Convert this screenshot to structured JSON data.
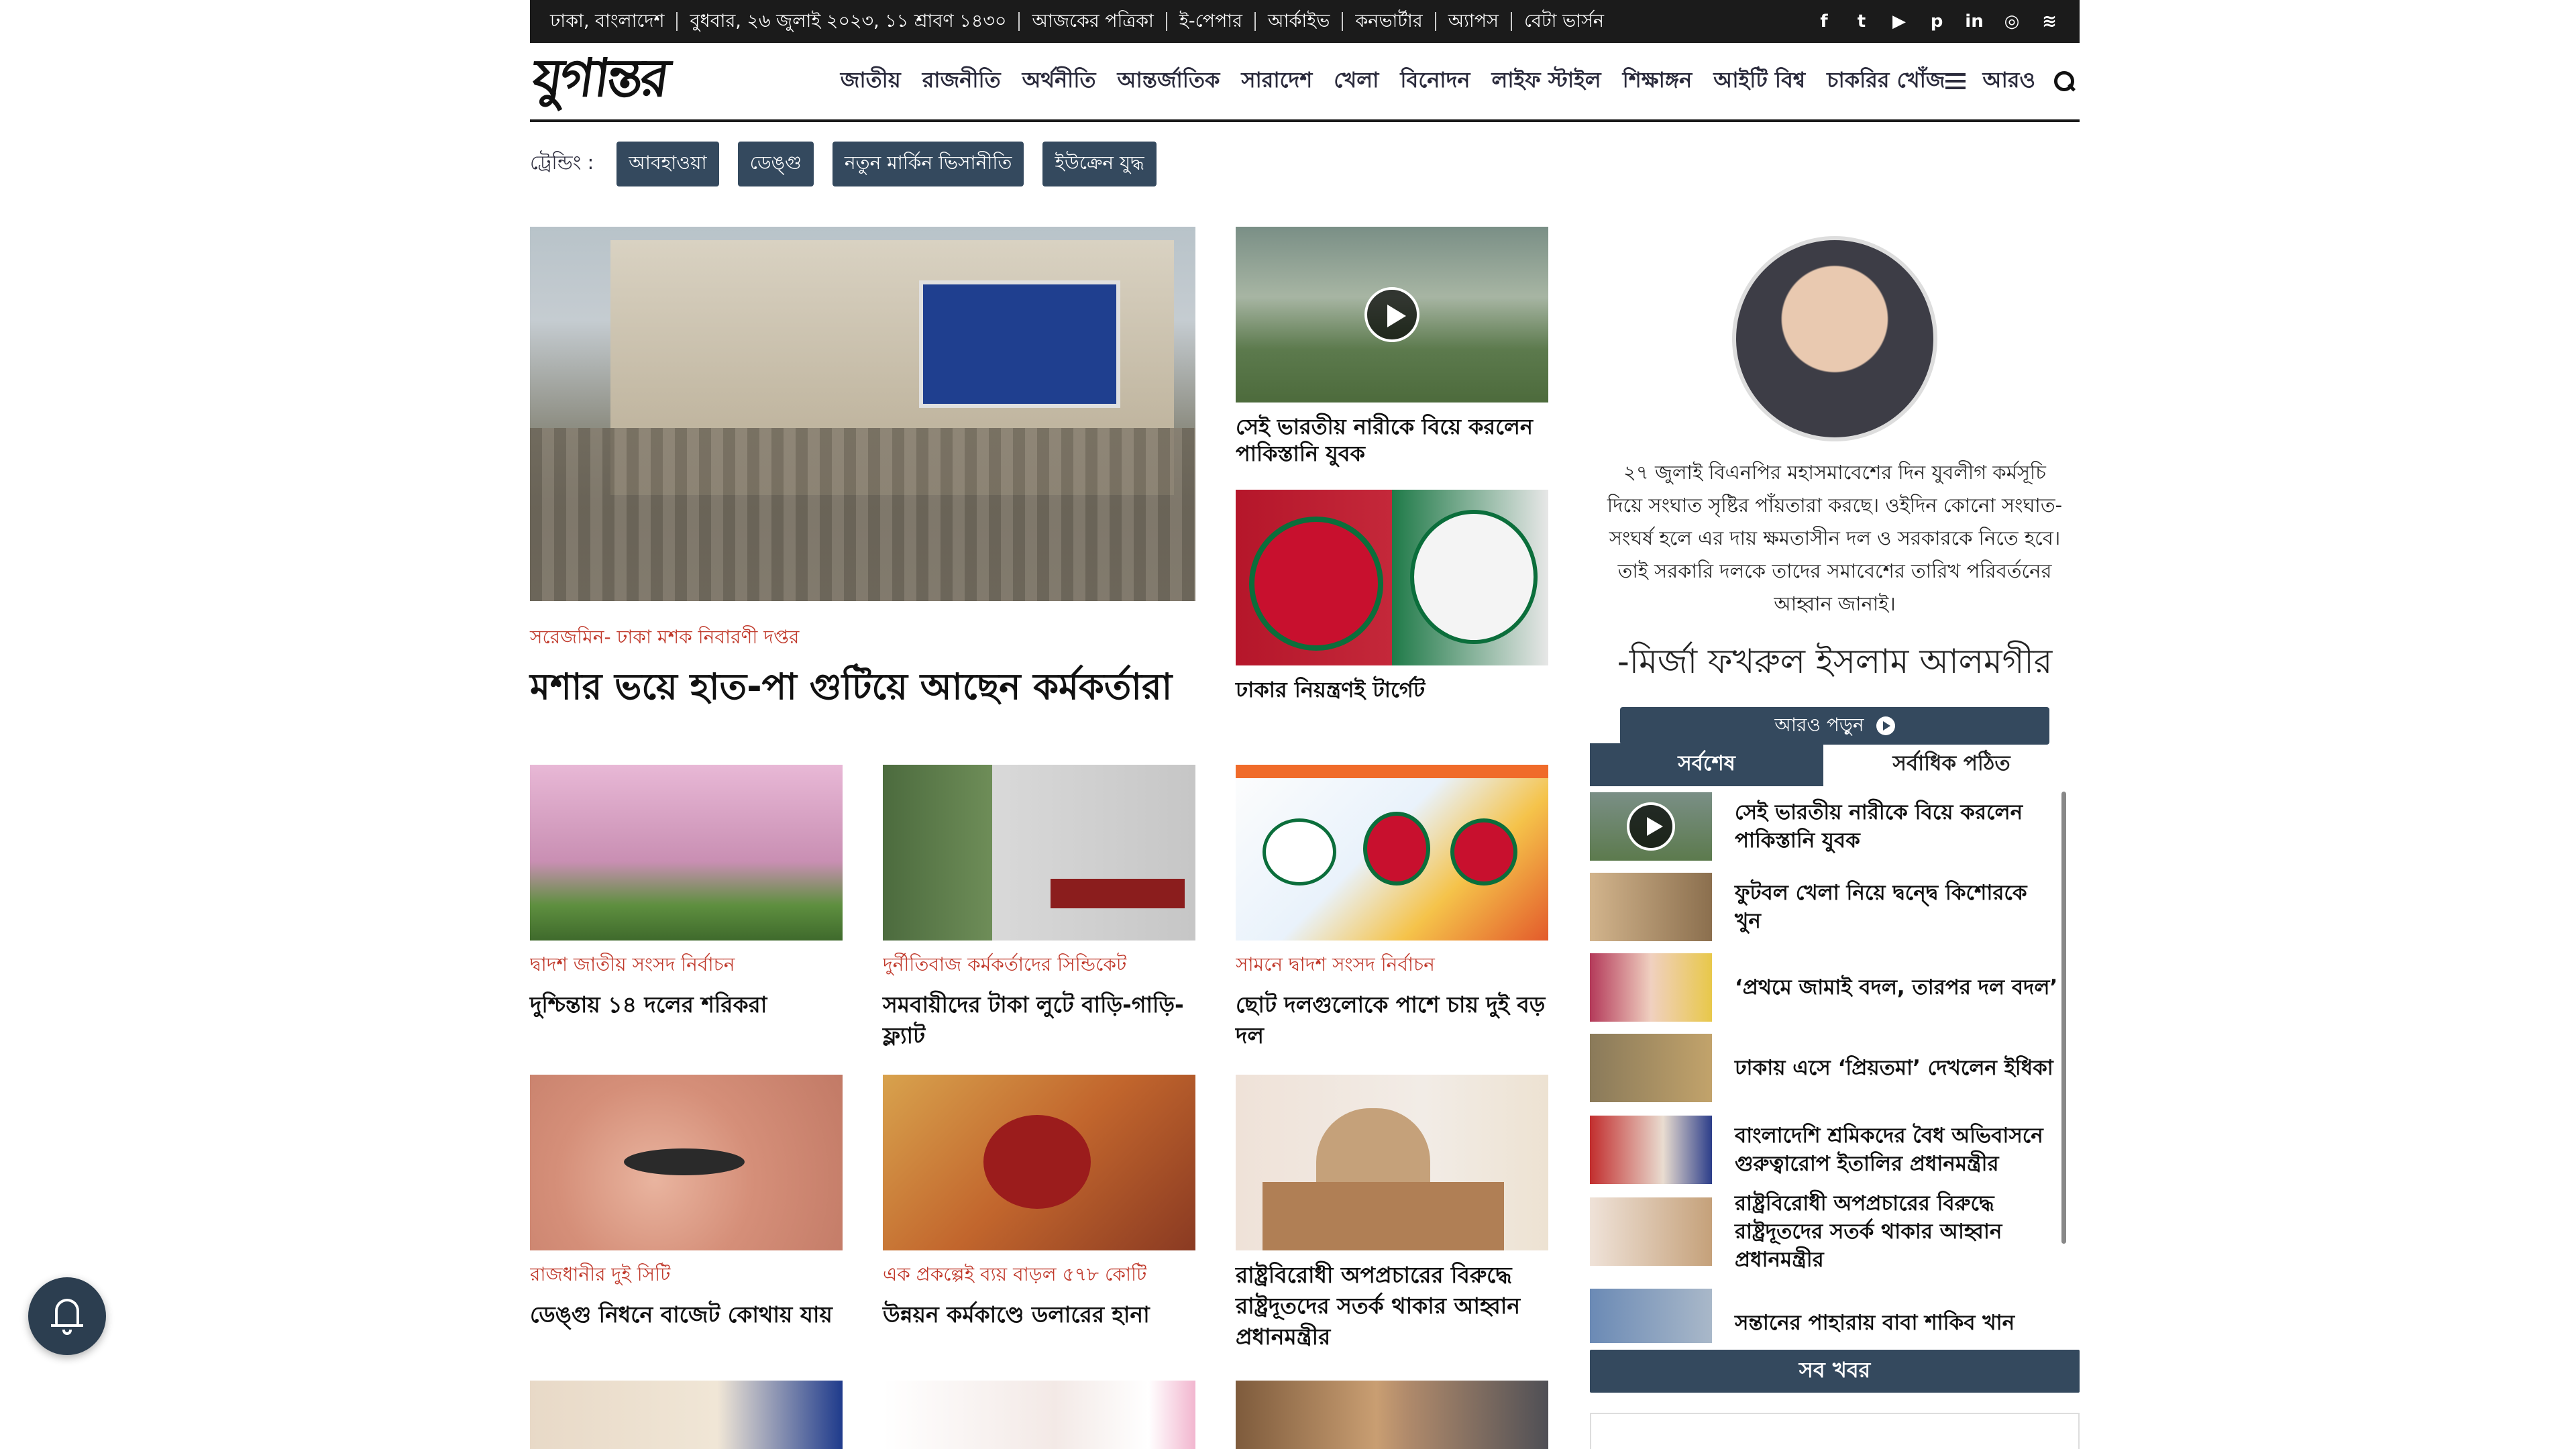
{
  "topbar": {
    "links": [
      "ঢাকা, বাংলাদেশ",
      "বুধবার, ২৬ জুলাই ২০২৩, ১১ শ্রাবণ ১৪৩০",
      "আজকের পত্রিকা",
      "ই-পেপার",
      "আর্কাইভ",
      "কনভার্টার",
      "অ্যাপস",
      "বেটা ভার্সন"
    ],
    "social": [
      "f",
      "t",
      "▶",
      "p",
      "in",
      "◎",
      "≋"
    ]
  },
  "header": {
    "logo": "যুগান্তর",
    "nav": [
      "জাতীয়",
      "রাজনীতি",
      "অর্থনীতি",
      "আন্তর্জাতিক",
      "সারাদেশ",
      "খেলা",
      "বিনোদন",
      "লাইফ স্টাইল",
      "শিক্ষাঙ্গন",
      "আইটি বিশ্ব",
      "চাকরির খোঁজ"
    ],
    "more": "আরও"
  },
  "trending": {
    "label": "ট্রেন্ডিং :",
    "tags": [
      "আবহাওয়া",
      "ডেঙ্গু",
      "নতুন মার্কিন ভিসানীতি",
      "ইউক্রেন যুদ্ধ"
    ]
  },
  "lead": {
    "kicker": "সরেজমিন- ঢাকা মশক নিবারণী দপ্তর",
    "title": "মশার ভয়ে হাত-পা গুটিয়ে আছেন কর্মকর্তারা"
  },
  "side_stories": [
    {
      "title": "সেই ভারতীয় নারীকে বিয়ে করলেন পাকিস্তানি যুবক"
    },
    {
      "title": "ঢাকার নিয়ন্ত্রণই টার্গেট"
    }
  ],
  "cards": [
    {
      "kicker": "দ্বাদশ জাতীয় সংসদ নির্বাচন",
      "title": "দুশ্চিন্তায় ১৪ দলের শরিকরা"
    },
    {
      "kicker": "দুর্নীতিবাজ কর্মকর্তাদের সিন্ডিকেট",
      "title": "সমবায়ীদের টাকা লুটে বাড়ি-গাড়ি-ফ্ল্যাট"
    },
    {
      "kicker": "সামনে দ্বাদশ সংসদ নির্বাচন",
      "title": "ছোট দলগুলোকে পাশে চায় দুই বড় দল"
    },
    {
      "kicker": "রাজধানীর দুই সিটি",
      "title": "ডেঙ্গু নিধনে বাজেট কোথায় যায়"
    },
    {
      "kicker": "এক প্রকল্পেই ব্যয় বাড়ল ৫৭৮ কোটি",
      "title": "উন্নয়ন কর্মকাণ্ডে ডলারের হানা"
    },
    {
      "kicker": "",
      "title": "রাষ্ট্রবিরোধী অপপ্রচারের বিরুদ্ধে রাষ্ট্রদূতদের সতর্ক থাকার আহ্বান প্রধানমন্ত্রীর"
    }
  ],
  "quote": {
    "text": "২৭ জুলাই বিএনপির মহাসমাবেশের দিন যুবলীগ কর্মসূচি দিয়ে সংঘাত সৃষ্টির পাঁয়তারা করছে। ওইদিন কোনো সংঘাত-সংঘর্ষ হলে এর দায় ক্ষমতাসীন দল ও সরকারকে নিতে হবে। তাই সরকারি দলকে তাদের সমাবেশের তারিখ পরিবর্তনের আহ্বান জানাই।",
    "author": "-মির্জা ফখরুল ইসলাম আলমগীর",
    "button": "আরও পড়ুন"
  },
  "tabs": {
    "latest": "সর্বশেষ",
    "most_read": "সর্বাধিক পঠিত"
  },
  "latest": [
    "সেই ভারতীয় নারীকে বিয়ে করলেন পাকিস্তানি যুবক",
    "ফুটবল খেলা নিয়ে দ্বন্দ্বে কিশোরকে খুন",
    "‘প্রথমে জামাই বদল, তারপর দল বদল’",
    "ঢাকায় এসে ‘প্রিয়তমা’ দেখলেন ইধিকা",
    "বাংলাদেশি শ্রমিকদের বৈধ অভিবাসনে গুরুত্বারোপ ইতালির প্রধানমন্ত্রীর",
    "রাষ্ট্রবিরোধী অপপ্রচারের বিরুদ্ধে রাষ্ট্রদূতদের সতর্ক থাকার আহ্বান প্রধানমন্ত্রীর",
    "সন্তানের পাহারায় বাবা শাকিব খান"
  ],
  "all_news": "সব খবর",
  "colors": {
    "dark": "#1b1b1b",
    "accent": "#34495e",
    "kicker": "#c0392b"
  }
}
